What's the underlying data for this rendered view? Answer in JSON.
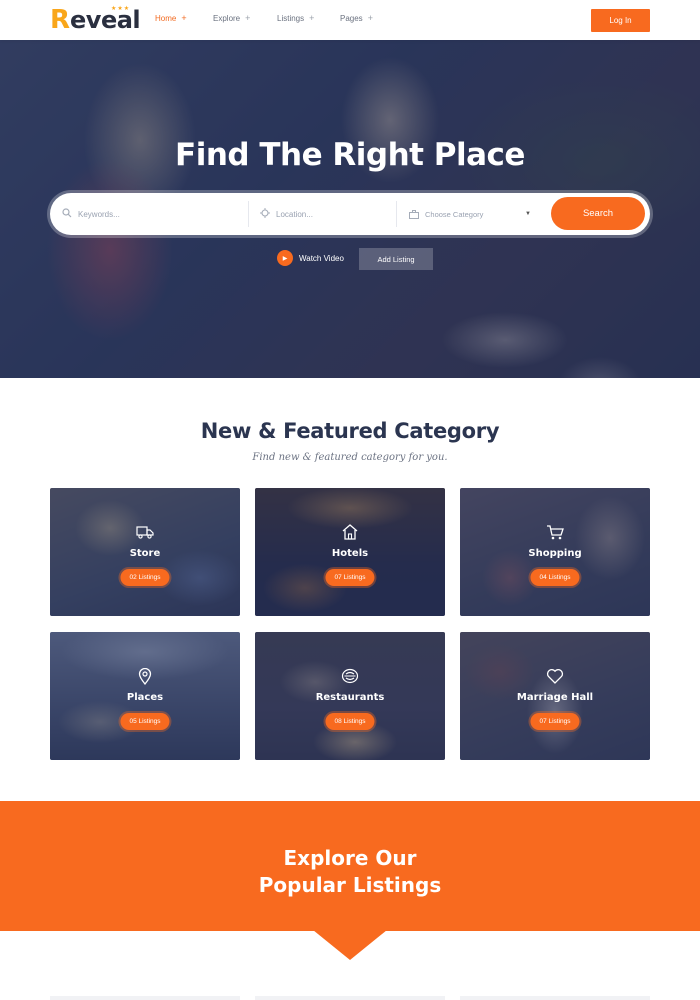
{
  "header": {
    "logo_first": "R",
    "logo_rest": "eveal",
    "nav": [
      {
        "label": "Home",
        "active": true
      },
      {
        "label": "Explore",
        "active": false
      },
      {
        "label": "Listings",
        "active": false
      },
      {
        "label": "Pages",
        "active": false
      }
    ],
    "login_label": "Log In"
  },
  "hero": {
    "title": "Find The Right Place",
    "search": {
      "keywords_placeholder": "Keywords...",
      "location_placeholder": "Location...",
      "category_selected": "Choose Category",
      "button_label": "Search"
    },
    "watch_video_label": "Watch Video",
    "add_listing_label": "Add Listing"
  },
  "categories": {
    "title": "New & Featured Category",
    "subtitle": "Find new & featured category for you.",
    "items": [
      {
        "name": "Store",
        "listings": "02 Listings",
        "icon": "truck-icon"
      },
      {
        "name": "Hotels",
        "listings": "07 Listings",
        "icon": "home-icon"
      },
      {
        "name": "Shopping",
        "listings": "04 Listings",
        "icon": "cart-icon"
      },
      {
        "name": "Places",
        "listings": "05 Listings",
        "icon": "location-pin-icon"
      },
      {
        "name": "Restaurants",
        "listings": "08 Listings",
        "icon": "food-dish-icon"
      },
      {
        "name": "Marriage Hall",
        "listings": "07 Listings",
        "icon": "heart-icon"
      }
    ]
  },
  "explore": {
    "line1": "Explore Our",
    "line2": "Popular Listings"
  },
  "colors": {
    "accent": "#f86a1f",
    "dark_text": "#2b3550",
    "logo_accent": "#f9a61a"
  }
}
